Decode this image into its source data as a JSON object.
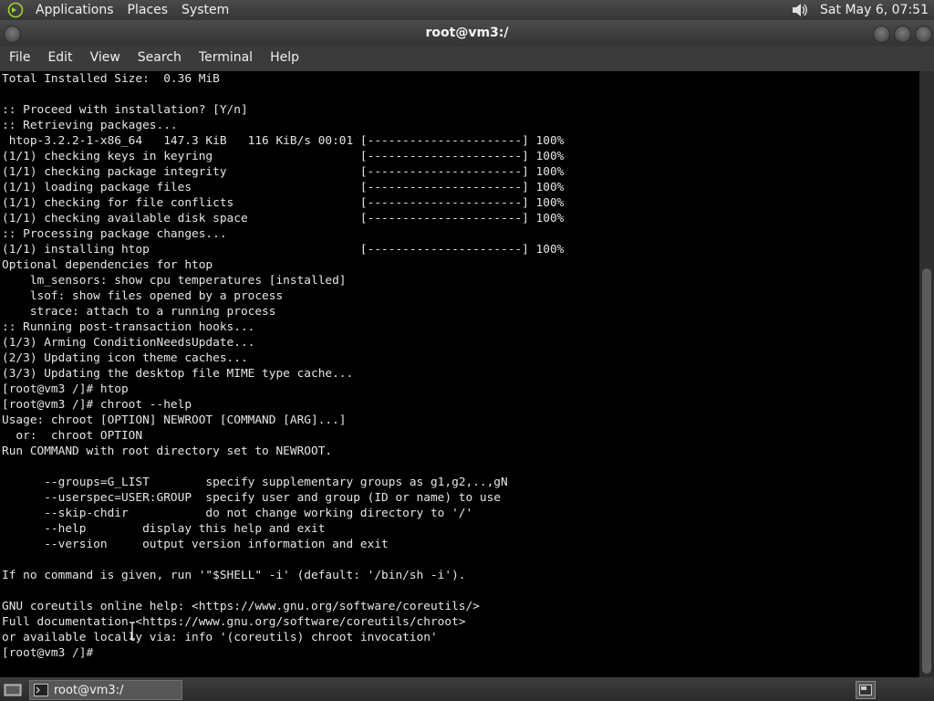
{
  "top_panel": {
    "menu": [
      "Applications",
      "Places",
      "System"
    ],
    "clock": "Sat May  6, 07:51"
  },
  "window": {
    "title": "root@vm3:/",
    "menu": [
      "File",
      "Edit",
      "View",
      "Search",
      "Terminal",
      "Help"
    ]
  },
  "terminal": {
    "lines": [
      "Total Installed Size:  0.36 MiB",
      "",
      ":: Proceed with installation? [Y/n]",
      ":: Retrieving packages...",
      " htop-3.2.2-1-x86_64   147.3 KiB   116 KiB/s 00:01 [----------------------] 100%",
      "(1/1) checking keys in keyring                     [----------------------] 100%",
      "(1/1) checking package integrity                   [----------------------] 100%",
      "(1/1) loading package files                        [----------------------] 100%",
      "(1/1) checking for file conflicts                  [----------------------] 100%",
      "(1/1) checking available disk space                [----------------------] 100%",
      ":: Processing package changes...",
      "(1/1) installing htop                              [----------------------] 100%",
      "Optional dependencies for htop",
      "    lm_sensors: show cpu temperatures [installed]",
      "    lsof: show files opened by a process",
      "    strace: attach to a running process",
      ":: Running post-transaction hooks...",
      "(1/3) Arming ConditionNeedsUpdate...",
      "(2/3) Updating icon theme caches...",
      "(3/3) Updating the desktop file MIME type cache...",
      "[root@vm3 /]# htop",
      "[root@vm3 /]# chroot --help",
      "Usage: chroot [OPTION] NEWROOT [COMMAND [ARG]...]",
      "  or:  chroot OPTION",
      "Run COMMAND with root directory set to NEWROOT.",
      "",
      "      --groups=G_LIST        specify supplementary groups as g1,g2,..,gN",
      "      --userspec=USER:GROUP  specify user and group (ID or name) to use",
      "      --skip-chdir           do not change working directory to '/'",
      "      --help        display this help and exit",
      "      --version     output version information and exit",
      "",
      "If no command is given, run '\"$SHELL\" -i' (default: '/bin/sh -i').",
      "",
      "GNU coreutils online help: <https://www.gnu.org/software/coreutils/>",
      "Full documentation <https://www.gnu.org/software/coreutils/chroot>",
      "or available locally via: info '(coreutils) chroot invocation'",
      "[root@vm3 /]#"
    ]
  },
  "taskbar": {
    "task_label": "root@vm3:/"
  },
  "icons": {
    "logo": "distro-logo-icon",
    "volume": "volume-icon",
    "show_desktop": "show-desktop-icon",
    "terminal": "terminal-icon",
    "workspace": "workspace-switcher-icon"
  }
}
